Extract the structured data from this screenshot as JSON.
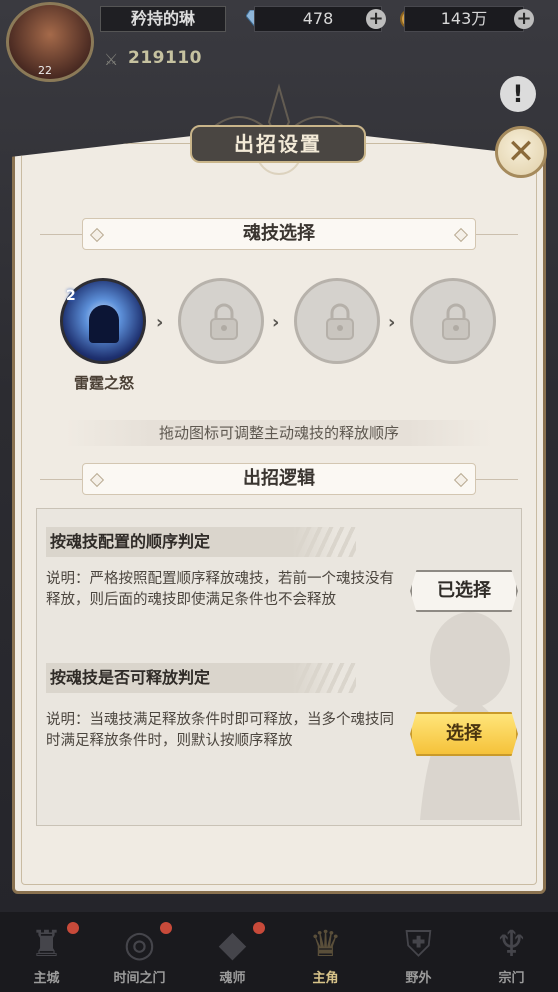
{
  "topbar": {
    "player_name": "矜持的琳",
    "avatar_level": "22",
    "gems": "478",
    "gold": "143万",
    "combat_power": "219110"
  },
  "dialog": {
    "title": "出招设置",
    "close_symbol": "✕",
    "skill_section": {
      "header": "魂技选择",
      "active_skill": {
        "name": "雷霆之怒",
        "badge": "2"
      },
      "locked_slots": 3,
      "hint": "拖动图标可调整主动魂技的释放顺序"
    },
    "logic_section": {
      "header": "出招逻辑",
      "options": [
        {
          "title": "按魂技配置的顺序判定",
          "description": "说明：严格按照配置顺序释放魂技，若前一个魂技没有释放，则后面的魂技即使满足条件也不会释放",
          "button": "已选择"
        },
        {
          "title": "按魂技是否可释放判定",
          "description": "说明：当魂技满足释放条件时即可释放，当多个魂技同时满足释放条件时，则默认按顺序释放",
          "button": "选择"
        }
      ]
    }
  },
  "bottom_nav": {
    "items": [
      {
        "label": "主城",
        "icon": "castle-icon"
      },
      {
        "label": "时间之门",
        "icon": "time-gate-icon"
      },
      {
        "label": "魂师",
        "icon": "soul-master-icon"
      },
      {
        "label": "主角",
        "icon": "hero-icon"
      },
      {
        "label": "野外",
        "icon": "field-icon"
      },
      {
        "label": "宗门",
        "icon": "sect-icon"
      }
    ]
  },
  "colors": {
    "panel_bg": "#f0ebe3",
    "accent_gold": "#f5c23a",
    "title_plate": "#4a4642"
  }
}
